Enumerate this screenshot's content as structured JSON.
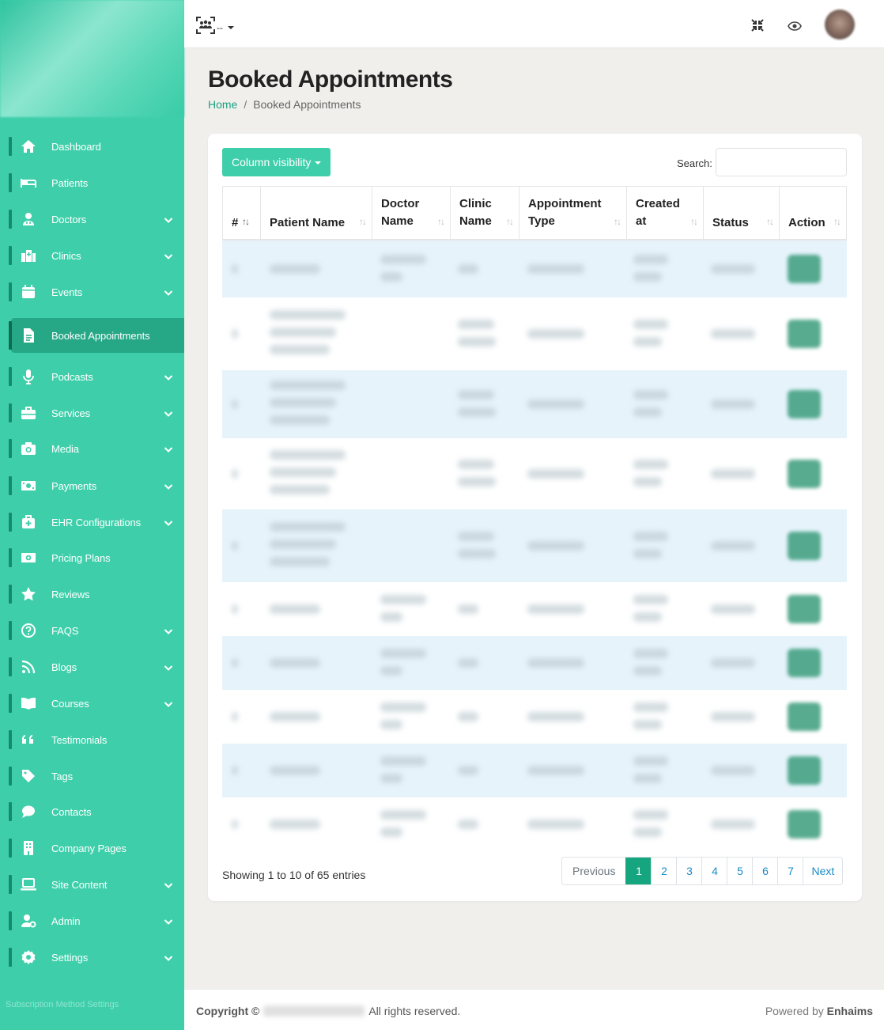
{
  "sidebar": {
    "items": [
      {
        "label": "Dashboard",
        "icon": "home-icon",
        "has_chevron": false
      },
      {
        "label": "Patients",
        "icon": "bed-icon",
        "has_chevron": false
      },
      {
        "label": "Doctors",
        "icon": "user-doctor-icon",
        "has_chevron": true
      },
      {
        "label": "Clinics",
        "icon": "hospital-icon",
        "has_chevron": true
      },
      {
        "label": "Events",
        "icon": "calendar-icon",
        "has_chevron": true
      },
      {
        "label": "Booked Appointments",
        "icon": "file-icon",
        "has_chevron": false,
        "active": true
      },
      {
        "label": "Podcasts",
        "icon": "microphone-icon",
        "has_chevron": true
      },
      {
        "label": "Services",
        "icon": "briefcase-icon",
        "has_chevron": true
      },
      {
        "label": "Media",
        "icon": "camera-icon",
        "has_chevron": true
      },
      {
        "label": "Payments",
        "icon": "money-icon",
        "has_chevron": true
      },
      {
        "label": "EHR Configurations",
        "icon": "medkit-icon",
        "has_chevron": true
      },
      {
        "label": "Pricing Plans",
        "icon": "money-bill-icon",
        "has_chevron": false
      },
      {
        "label": "Reviews",
        "icon": "star-icon",
        "has_chevron": false
      },
      {
        "label": "FAQS",
        "icon": "question-icon",
        "has_chevron": true
      },
      {
        "label": "Blogs",
        "icon": "rss-icon",
        "has_chevron": true
      },
      {
        "label": "Courses",
        "icon": "book-open-icon",
        "has_chevron": true
      },
      {
        "label": "Testimonials",
        "icon": "quote-icon",
        "has_chevron": false
      },
      {
        "label": "Tags",
        "icon": "tag-icon",
        "has_chevron": false
      },
      {
        "label": "Contacts",
        "icon": "comment-icon",
        "has_chevron": false
      },
      {
        "label": "Company Pages",
        "icon": "building-icon",
        "has_chevron": false
      },
      {
        "label": "Site Content",
        "icon": "laptop-icon",
        "has_chevron": true
      },
      {
        "label": "Admin",
        "icon": "user-gear-icon",
        "has_chevron": true
      },
      {
        "label": "Settings",
        "icon": "gear-icon",
        "has_chevron": true
      }
    ],
    "subscription_label": "Subscription Method Settings"
  },
  "topbar": {
    "group_label": "--",
    "group_icon": "users-scan-icon",
    "fullscreen_icon": "compress-icon",
    "preview_icon": "eye-icon"
  },
  "page": {
    "title": "Booked Appointments",
    "breadcrumb_home": "Home",
    "breadcrumb_sep": "/",
    "breadcrumb_current": "Booked Appointments"
  },
  "table": {
    "column_visibility": "Column visibility",
    "search_label": "Search:",
    "columns": [
      {
        "label": "#"
      },
      {
        "label": "Patient Name"
      },
      {
        "label": "Doctor Name"
      },
      {
        "label": "Clinic Name"
      },
      {
        "label": "Appointment Type"
      },
      {
        "label": "Created at"
      },
      {
        "label": "Status"
      },
      {
        "label": "Action"
      }
    ],
    "info": "Showing 1 to 10 of 65 entries",
    "pagination": {
      "previous": "Previous",
      "pages": [
        "1",
        "2",
        "3",
        "4",
        "5",
        "6",
        "7"
      ],
      "active": "1",
      "next": "Next"
    }
  },
  "footer": {
    "copyright": "Copyright ©",
    "rights": "All rights reserved.",
    "powered_prefix": "Powered by",
    "powered_brand": "Enhaims"
  },
  "colors": {
    "sidebar": "#3ecfaa",
    "accent": "#15a67f",
    "link": "#1a8cc6",
    "row_stripe": "#e6f3fb"
  }
}
